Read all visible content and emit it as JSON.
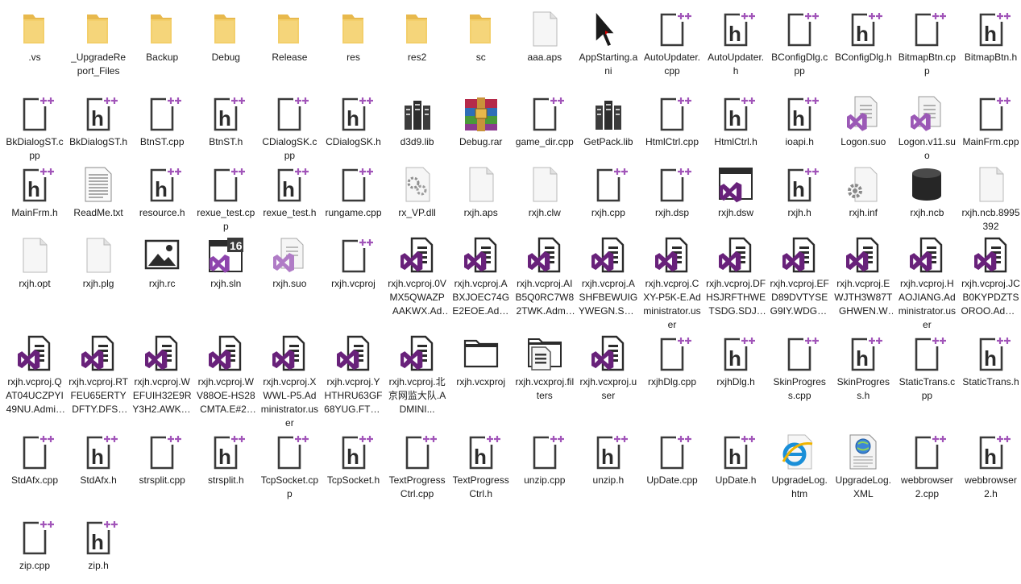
{
  "window": {
    "view": "large-icons"
  },
  "colors": {
    "folder": "#f3cf6b",
    "folder_dark": "#e8b94d",
    "plus": "#a155b9",
    "doc_stroke": "#3a3a3a",
    "vs_purple": "#68217a"
  },
  "files": [
    {
      "name": ".vs",
      "icon": "folder-icon"
    },
    {
      "name": "_UpgradeReport_Files",
      "icon": "folder-icon"
    },
    {
      "name": "Backup",
      "icon": "folder-icon"
    },
    {
      "name": "Debug",
      "icon": "folder-icon"
    },
    {
      "name": "Release",
      "icon": "folder-icon"
    },
    {
      "name": "res",
      "icon": "folder-icon"
    },
    {
      "name": "res2",
      "icon": "folder-icon"
    },
    {
      "name": "sc",
      "icon": "folder-icon"
    },
    {
      "name": "aaa.aps",
      "icon": "blank-file-icon"
    },
    {
      "name": "AppStarting.ani",
      "icon": "animated-cursor-icon"
    },
    {
      "name": "AutoUpdater.cpp",
      "icon": "cpp-file-icon"
    },
    {
      "name": "AutoUpdater.h",
      "icon": "h-file-icon"
    },
    {
      "name": "BConfigDlg.cpp",
      "icon": "cpp-file-icon"
    },
    {
      "name": "BConfigDlg.h",
      "icon": "h-file-icon"
    },
    {
      "name": "BitmapBtn.cpp",
      "icon": "cpp-file-icon"
    },
    {
      "name": "BitmapBtn.h",
      "icon": "h-file-icon"
    },
    {
      "name": "BkDialogST.cpp",
      "icon": "cpp-file-icon"
    },
    {
      "name": "BkDialogST.h",
      "icon": "h-file-icon"
    },
    {
      "name": "BtnST.cpp",
      "icon": "cpp-file-icon"
    },
    {
      "name": "BtnST.h",
      "icon": "h-file-icon"
    },
    {
      "name": "CDialogSK.cpp",
      "icon": "cpp-file-icon"
    },
    {
      "name": "CDialogSK.h",
      "icon": "h-file-icon"
    },
    {
      "name": "d3d9.lib",
      "icon": "library-icon"
    },
    {
      "name": "Debug.rar",
      "icon": "rar-archive-icon"
    },
    {
      "name": "game_dir.cpp",
      "icon": "cpp-file-icon"
    },
    {
      "name": "GetPack.lib",
      "icon": "library-icon"
    },
    {
      "name": "HtmlCtrl.cpp",
      "icon": "cpp-file-icon"
    },
    {
      "name": "HtmlCtrl.h",
      "icon": "h-file-icon"
    },
    {
      "name": "ioapi.h",
      "icon": "h-file-icon"
    },
    {
      "name": "Logon.suo",
      "icon": "vs-suo-icon"
    },
    {
      "name": "Logon.v11.suo",
      "icon": "vs-suo-icon"
    },
    {
      "name": "MainFrm.cpp",
      "icon": "cpp-file-icon"
    },
    {
      "name": "MainFrm.h",
      "icon": "h-file-icon"
    },
    {
      "name": "ReadMe.txt",
      "icon": "text-file-icon"
    },
    {
      "name": "resource.h",
      "icon": "h-file-icon"
    },
    {
      "name": "rexue_test.cpp",
      "icon": "cpp-file-icon"
    },
    {
      "name": "rexue_test.h",
      "icon": "h-file-icon"
    },
    {
      "name": "rungame.cpp",
      "icon": "cpp-file-icon"
    },
    {
      "name": "rx_VP.dll",
      "icon": "dll-gear-icon"
    },
    {
      "name": "rxjh.aps",
      "icon": "blank-file-icon"
    },
    {
      "name": "rxjh.clw",
      "icon": "blank-file-icon"
    },
    {
      "name": "rxjh.cpp",
      "icon": "cpp-file-icon"
    },
    {
      "name": "rxjh.dsp",
      "icon": "cpp-file-icon"
    },
    {
      "name": "rxjh.dsw",
      "icon": "vs-window-icon"
    },
    {
      "name": "rxjh.h",
      "icon": "h-file-icon"
    },
    {
      "name": "rxjh.inf",
      "icon": "inf-settings-icon"
    },
    {
      "name": "rxjh.ncb",
      "icon": "database-icon"
    },
    {
      "name": "rxjh.ncb.8995392",
      "icon": "blank-file-icon"
    },
    {
      "name": "rxjh.opt",
      "icon": "blank-file-icon"
    },
    {
      "name": "rxjh.plg",
      "icon": "blank-file-icon"
    },
    {
      "name": "rxjh.rc",
      "icon": "image-resource-icon"
    },
    {
      "name": "rxjh.sln",
      "icon": "vs-solution-16-icon"
    },
    {
      "name": "rxjh.suo",
      "icon": "vs-suo-light-icon"
    },
    {
      "name": "rxjh.vcproj",
      "icon": "cpp-file-icon"
    },
    {
      "name": "rxjh.vcproj.0VMX5QWAZPAAKWX.Adm...",
      "icon": "vs-project-icon"
    },
    {
      "name": "rxjh.vcproj.ABXJOEC74GE2EOE.Adminis...",
      "icon": "vs-project-icon"
    },
    {
      "name": "rxjh.vcproj.AIB5Q0RC7W82TWK.Admini...",
      "icon": "vs-project-icon"
    },
    {
      "name": "rxjh.vcproj.ASHFBEWUIGYWEGN.SDHJF...",
      "icon": "vs-project-icon"
    },
    {
      "name": "rxjh.vcproj.CXY-P5K-E.Administrator.user",
      "icon": "vs-project-icon"
    },
    {
      "name": "rxjh.vcproj.DFHSJRFTHWETSDG.SDJAHG...",
      "icon": "vs-project-icon"
    },
    {
      "name": "rxjh.vcproj.EFD89DVTYSEG9IY.WDG8SA...",
      "icon": "vs-project-icon"
    },
    {
      "name": "rxjh.vcproj.EWJTH3W87TGHWEN.WE...",
      "icon": "vs-project-icon"
    },
    {
      "name": "rxjh.vcproj.HAOJIANG.Administrator.user",
      "icon": "vs-project-icon"
    },
    {
      "name": "rxjh.vcproj.JCB0KYPDZTSOROO.Adminis...",
      "icon": "vs-project-icon"
    },
    {
      "name": "rxjh.vcproj.QAT04UCZPYI49NU.Administ...",
      "icon": "vs-project-icon"
    },
    {
      "name": "rxjh.vcproj.RTFEU65ERTYDFTY.DFSDGT...",
      "icon": "vs-project-icon"
    },
    {
      "name": "rxjh.vcproj.WEFUIH32E9RY3H2.AWKJFH...",
      "icon": "vs-project-icon"
    },
    {
      "name": "rxjh.vcproj.WV88OE-HS28CMTA.E#286...",
      "icon": "vs-project-icon"
    },
    {
      "name": "rxjh.vcproj.XWWL-P5.Administrator.user",
      "icon": "vs-project-icon"
    },
    {
      "name": "rxjh.vcproj.YHTHRU63GF68YUG.FTD5FC...",
      "icon": "vs-project-icon"
    },
    {
      "name": "rxjh.vcproj.北京网监大队.ADMINI...",
      "icon": "vs-project-icon"
    },
    {
      "name": "rxjh.vcxproj",
      "icon": "vcxproj-folder-icon"
    },
    {
      "name": "rxjh.vcxproj.filters",
      "icon": "vcxproj-filters-icon"
    },
    {
      "name": "rxjh.vcxproj.user",
      "icon": "vs-project-icon"
    },
    {
      "name": "rxjhDlg.cpp",
      "icon": "cpp-file-icon"
    },
    {
      "name": "rxjhDlg.h",
      "icon": "h-file-icon"
    },
    {
      "name": "SkinProgress.cpp",
      "icon": "cpp-file-icon"
    },
    {
      "name": "SkinProgress.h",
      "icon": "h-file-icon"
    },
    {
      "name": "StaticTrans.cpp",
      "icon": "cpp-file-icon"
    },
    {
      "name": "StaticTrans.h",
      "icon": "h-file-icon"
    },
    {
      "name": "StdAfx.cpp",
      "icon": "cpp-file-icon"
    },
    {
      "name": "StdAfx.h",
      "icon": "h-file-icon"
    },
    {
      "name": "strsplit.cpp",
      "icon": "cpp-file-icon"
    },
    {
      "name": "strsplit.h",
      "icon": "h-file-icon"
    },
    {
      "name": "TcpSocket.cpp",
      "icon": "cpp-file-icon"
    },
    {
      "name": "TcpSocket.h",
      "icon": "h-file-icon"
    },
    {
      "name": "TextProgressCtrl.cpp",
      "icon": "cpp-file-icon"
    },
    {
      "name": "TextProgressCtrl.h",
      "icon": "h-file-icon"
    },
    {
      "name": "unzip.cpp",
      "icon": "cpp-file-icon"
    },
    {
      "name": "unzip.h",
      "icon": "h-file-icon"
    },
    {
      "name": "UpDate.cpp",
      "icon": "cpp-file-icon"
    },
    {
      "name": "UpDate.h",
      "icon": "h-file-icon"
    },
    {
      "name": "UpgradeLog.htm",
      "icon": "ie-html-icon"
    },
    {
      "name": "UpgradeLog.XML",
      "icon": "xml-globe-icon"
    },
    {
      "name": "webbrowser2.cpp",
      "icon": "cpp-file-icon"
    },
    {
      "name": "webbrowser2.h",
      "icon": "h-file-icon"
    },
    {
      "name": "zip.cpp",
      "icon": "cpp-file-icon"
    },
    {
      "name": "zip.h",
      "icon": "h-file-icon"
    }
  ]
}
